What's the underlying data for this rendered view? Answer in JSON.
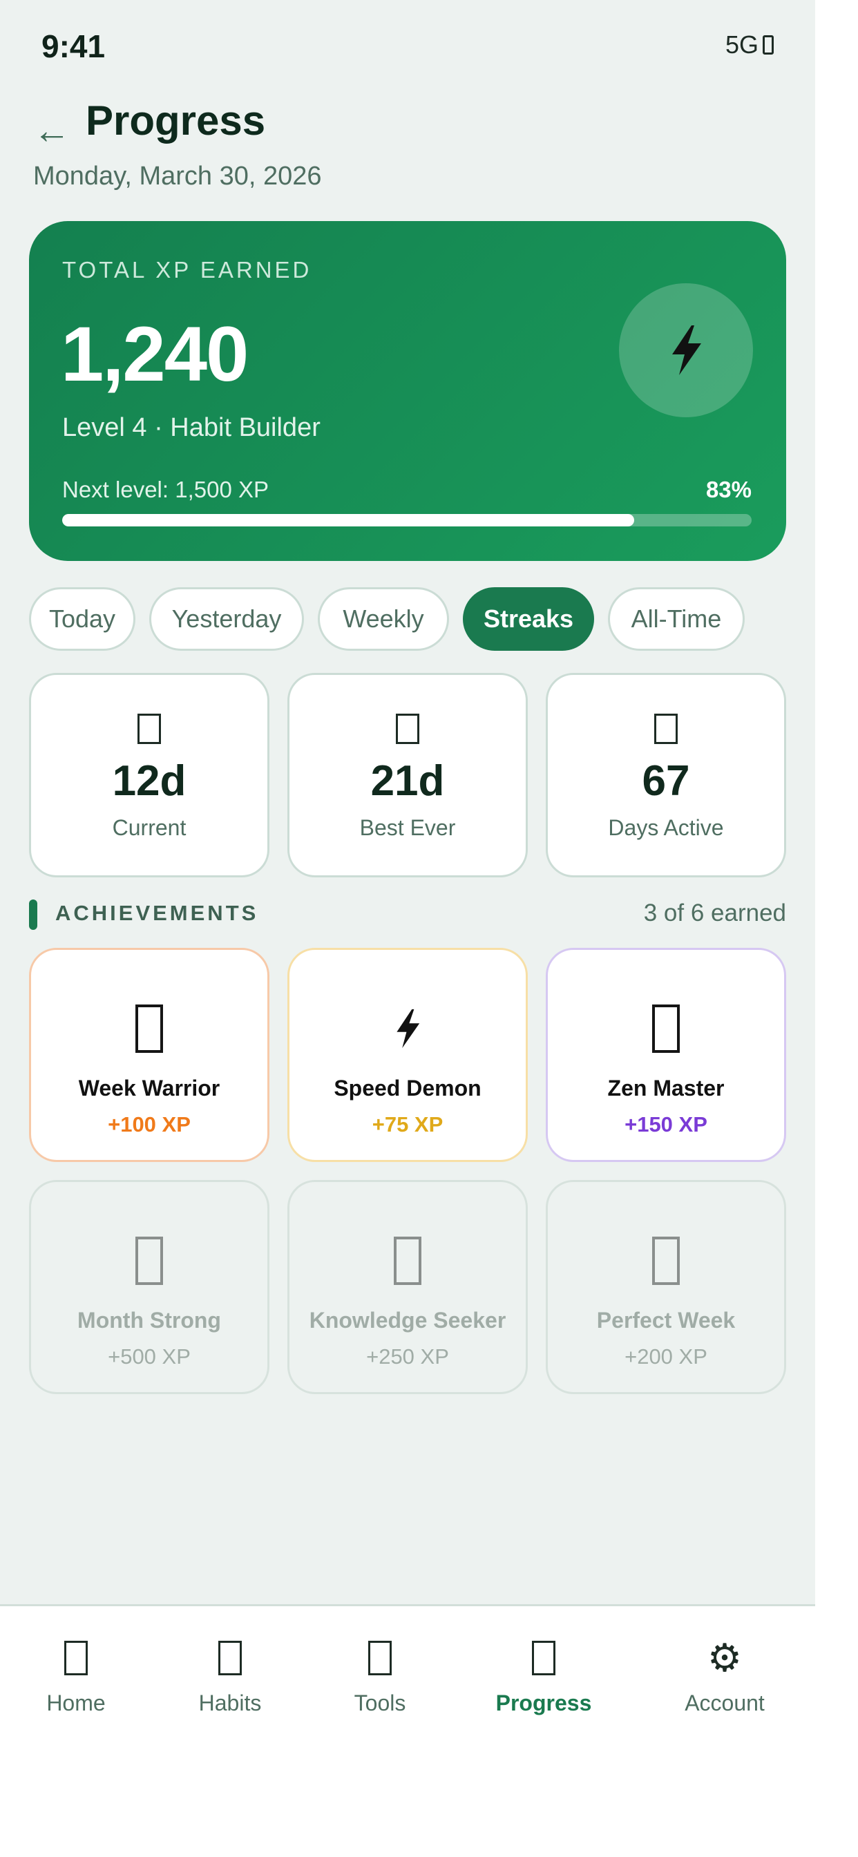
{
  "status_bar": {
    "time": "9:41",
    "network": "5G"
  },
  "header": {
    "title": "Progress",
    "date": "Monday, March 30, 2026"
  },
  "xp_card": {
    "label": "TOTAL XP EARNED",
    "value": "1,240",
    "level": "Level 4 · Habit Builder",
    "next_level": "Next level: 1,500 XP",
    "percent": "83%",
    "progress_fraction": 0.83,
    "badge_icon": "lightning-icon"
  },
  "tabs": [
    {
      "label": "Today",
      "active": false
    },
    {
      "label": "Yesterday",
      "active": false
    },
    {
      "label": "Weekly",
      "active": false
    },
    {
      "label": "Streaks",
      "active": true
    },
    {
      "label": "All-Time",
      "active": false
    }
  ],
  "stats": [
    {
      "value": "12d",
      "label": "Current"
    },
    {
      "value": "21d",
      "label": "Best Ever"
    },
    {
      "value": "67",
      "label": "Days Active"
    }
  ],
  "achievements": {
    "title": "ACHIEVEMENTS",
    "count": "3 of 6 earned",
    "items": [
      {
        "name": "Week Warrior",
        "xp": "+100 XP",
        "earned": true,
        "border": "#f7c9a8",
        "xp_color": "#f07a1a",
        "icon": "box"
      },
      {
        "name": "Speed Demon",
        "xp": "+75 XP",
        "earned": true,
        "border": "#f7dfa6",
        "xp_color": "#e0a91a",
        "icon": "lightning"
      },
      {
        "name": "Zen Master",
        "xp": "+150 XP",
        "earned": true,
        "border": "#d6c8f2",
        "xp_color": "#7a3bd6",
        "icon": "box"
      },
      {
        "name": "Month Strong",
        "xp": "+500 XP",
        "earned": false,
        "icon": "box"
      },
      {
        "name": "Knowledge Seeker",
        "xp": "+250 XP",
        "earned": false,
        "icon": "box"
      },
      {
        "name": "Perfect Week",
        "xp": "+200 XP",
        "earned": false,
        "icon": "box"
      }
    ]
  },
  "nav": {
    "items": [
      {
        "label": "Home",
        "active": false,
        "icon": "home-icon"
      },
      {
        "label": "Habits",
        "active": false,
        "icon": "habits-icon"
      },
      {
        "label": "Tools",
        "active": false,
        "icon": "tools-icon"
      },
      {
        "label": "Progress",
        "active": true,
        "icon": "progress-icon"
      },
      {
        "label": "Account",
        "active": false,
        "icon": "gear-icon"
      }
    ]
  },
  "colors": {
    "accent": "#1a7a4f",
    "card_gradient_start": "#14804f",
    "card_gradient_end": "#1a9c5c",
    "background": "#edf2f0"
  }
}
